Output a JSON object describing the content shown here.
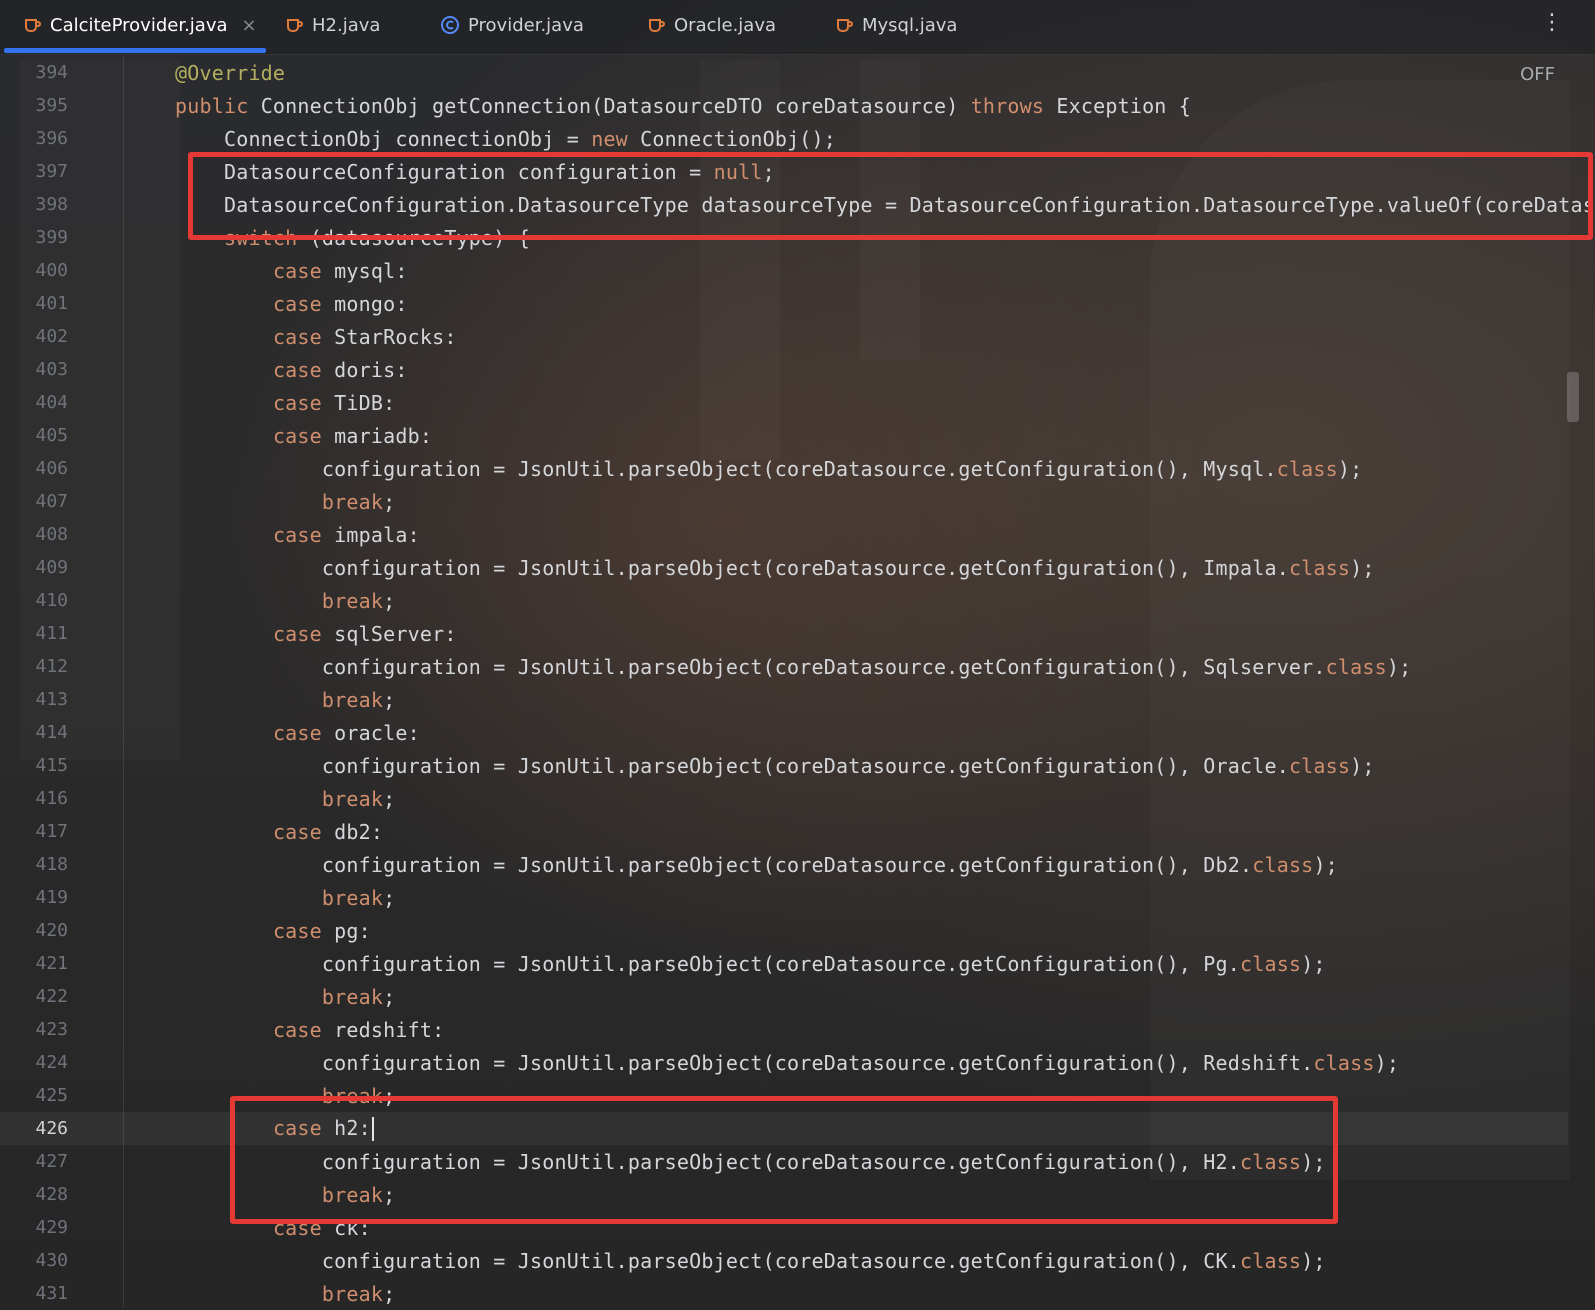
{
  "tabs": [
    {
      "label": "CalciteProvider.java",
      "icon": "java-file-icon",
      "active": true,
      "closable": true
    },
    {
      "label": "H2.java",
      "icon": "java-file-icon"
    },
    {
      "label": "Provider.java",
      "icon": "java-class-icon"
    },
    {
      "label": "Oracle.java",
      "icon": "java-file-icon"
    },
    {
      "label": "Mysql.java",
      "icon": "java-file-icon"
    }
  ],
  "tab_close_glyph": "×",
  "more_glyph": "⋮",
  "editor": {
    "inspection_toggle": "OFF",
    "current_line": "426",
    "lines": [
      {
        "n": "394",
        "code": "@Override"
      },
      {
        "n": "395",
        "code": "public ConnectionObj getConnection(DatasourceDTO coreDatasource) throws Exception {"
      },
      {
        "n": "396",
        "code": "    ConnectionObj connectionObj = new ConnectionObj();"
      },
      {
        "n": "397",
        "code": "    DatasourceConfiguration configuration = null;"
      },
      {
        "n": "398",
        "code": "    DatasourceConfiguration.DatasourceType datasourceType = DatasourceConfiguration.DatasourceType.valueOf(coreDataso"
      },
      {
        "n": "399",
        "code": "    switch (datasourceType) {"
      },
      {
        "n": "400",
        "code": "        case mysql:"
      },
      {
        "n": "401",
        "code": "        case mongo:"
      },
      {
        "n": "402",
        "code": "        case StarRocks:"
      },
      {
        "n": "403",
        "code": "        case doris:"
      },
      {
        "n": "404",
        "code": "        case TiDB:"
      },
      {
        "n": "405",
        "code": "        case mariadb:"
      },
      {
        "n": "406",
        "code": "            configuration = JsonUtil.parseObject(coreDatasource.getConfiguration(), Mysql.class);"
      },
      {
        "n": "407",
        "code": "            break;"
      },
      {
        "n": "408",
        "code": "        case impala:"
      },
      {
        "n": "409",
        "code": "            configuration = JsonUtil.parseObject(coreDatasource.getConfiguration(), Impala.class);"
      },
      {
        "n": "410",
        "code": "            break;"
      },
      {
        "n": "411",
        "code": "        case sqlServer:"
      },
      {
        "n": "412",
        "code": "            configuration = JsonUtil.parseObject(coreDatasource.getConfiguration(), Sqlserver.class);"
      },
      {
        "n": "413",
        "code": "            break;"
      },
      {
        "n": "414",
        "code": "        case oracle:"
      },
      {
        "n": "415",
        "code": "            configuration = JsonUtil.parseObject(coreDatasource.getConfiguration(), Oracle.class);"
      },
      {
        "n": "416",
        "code": "            break;"
      },
      {
        "n": "417",
        "code": "        case db2:"
      },
      {
        "n": "418",
        "code": "            configuration = JsonUtil.parseObject(coreDatasource.getConfiguration(), Db2.class);"
      },
      {
        "n": "419",
        "code": "            break;"
      },
      {
        "n": "420",
        "code": "        case pg:"
      },
      {
        "n": "421",
        "code": "            configuration = JsonUtil.parseObject(coreDatasource.getConfiguration(), Pg.class);"
      },
      {
        "n": "422",
        "code": "            break;"
      },
      {
        "n": "423",
        "code": "        case redshift:"
      },
      {
        "n": "424",
        "code": "            configuration = JsonUtil.parseObject(coreDatasource.getConfiguration(), Redshift.class);"
      },
      {
        "n": "425",
        "code": "            break;"
      },
      {
        "n": "426",
        "code": "        case h2:"
      },
      {
        "n": "427",
        "code": "            configuration = JsonUtil.parseObject(coreDatasource.getConfiguration(), H2.class);"
      },
      {
        "n": "428",
        "code": "            break;"
      },
      {
        "n": "429",
        "code": "        case ck:"
      },
      {
        "n": "430",
        "code": "            configuration = JsonUtil.parseObject(coreDatasource.getConfiguration(), CK.class);"
      },
      {
        "n": "431",
        "code": "            break;"
      }
    ]
  },
  "colors": {
    "keyword": "#cf8e6d",
    "annotation": "#b3ae60",
    "text": "#d4d6da",
    "highlight_box": "#e53935",
    "tab_accent": "#3574f0"
  }
}
